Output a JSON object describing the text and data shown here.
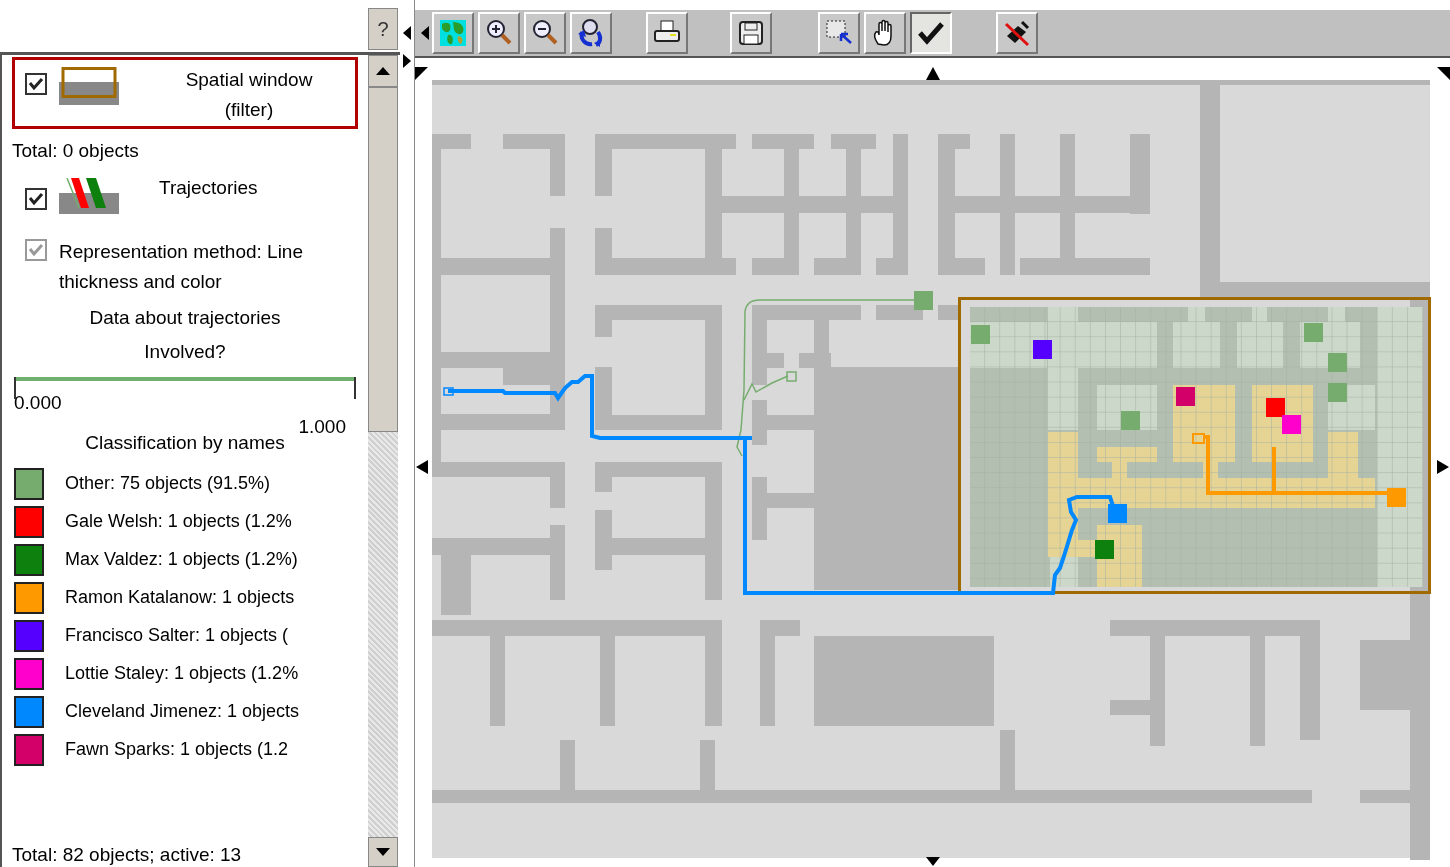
{
  "help_button": "?",
  "spatial_window": {
    "checked": true,
    "selected": true,
    "label": "Spatial window (filter)",
    "total": "Total: 0 objects"
  },
  "trajectories": {
    "checked": true,
    "selected": false,
    "label": "Trajectories",
    "representation": {
      "checked": true,
      "disabled": true,
      "label": "Representation method: Line thickness and color"
    },
    "data_title": "Data about trajectories",
    "attribute": "Involved?",
    "range": {
      "min_label": "0.000",
      "max_label": "1.000",
      "level": 1
    },
    "classification": {
      "title": "Classification by names",
      "items": [
        {
          "label": "Other: 75 objects (91.5%)",
          "color": "#76ad6e"
        },
        {
          "label": "Gale Welsh: 1 objects (1.2%",
          "color": "#ff0000"
        },
        {
          "label": "Max Valdez: 1 objects (1.2%)",
          "color": "#0d800d"
        },
        {
          "label": "Ramon Katalanow: 1 objects",
          "color": "#ff9900"
        },
        {
          "label": "Francisco Salter: 1 objects (",
          "color": "#5500ff"
        },
        {
          "label": "Lottie Staley: 1 objects (1.2%",
          "color": "#ff00cc"
        },
        {
          "label": "Cleveland Jimenez: 1 objects",
          "color": "#0088ff"
        },
        {
          "label": "Fawn Sparks: 1 objects (1.2",
          "color": "#d4006a"
        }
      ]
    }
  },
  "total": "Total: 82 objects; active: 13",
  "toolbar": [
    {
      "kind": "globe",
      "selected": false
    },
    {
      "kind": "zoom_in",
      "selected": false
    },
    {
      "kind": "zoom_out",
      "selected": false
    },
    {
      "kind": "reset",
      "selected": false
    },
    {
      "kind": "print",
      "selected": false
    },
    {
      "kind": "save",
      "selected": false
    },
    {
      "kind": "select",
      "selected": false
    },
    {
      "kind": "pan",
      "selected": false
    },
    {
      "kind": "check",
      "selected": true
    },
    {
      "kind": "erase",
      "selected": false
    }
  ]
}
